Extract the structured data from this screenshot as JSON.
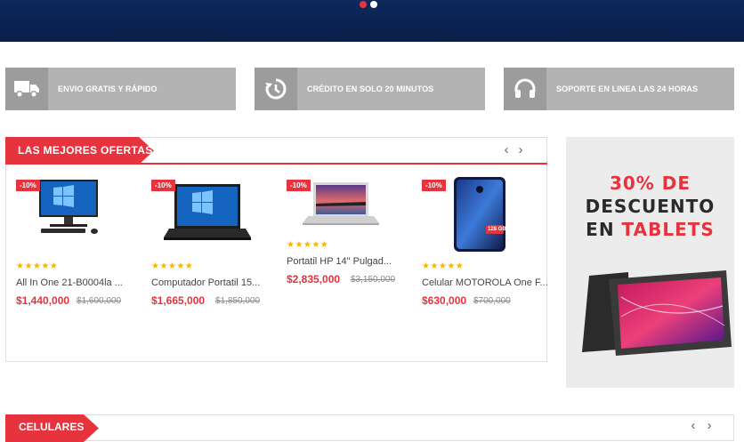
{
  "hero": {
    "slides": 2,
    "active_slide": 1
  },
  "features": [
    {
      "icon": "truck-icon",
      "label": "ENVIO GRATIS Y RÁPIDO"
    },
    {
      "icon": "history-icon",
      "label": "CRÉDITO EN SOLO 20 MINUTOS"
    },
    {
      "icon": "headphones-icon",
      "label": "SOPORTE EN LINEA LAS 24 HORAS"
    }
  ],
  "deals": {
    "title": "LAS MEJORES OFERTAS",
    "prev_arrow": "‹",
    "next_arrow": "›",
    "products": [
      {
        "badge": "-10%",
        "rating": "★★★★★",
        "name": "All In One 21-B0004la ...",
        "price": "$1,440,000",
        "old_price": "$1,600,000"
      },
      {
        "badge": "-10%",
        "rating": "★★★★★",
        "name": "Computador Portatil 15...",
        "price": "$1,665,000",
        "old_price": "$1,850,000"
      },
      {
        "badge": "-10%",
        "rating": "★★★★★",
        "name": "Portatil HP 14\" Pulgad...",
        "price": "$2,835,000",
        "old_price": "$3,150,000"
      },
      {
        "badge": "-10%",
        "rating": "★★★★★",
        "name": "Celular MOTOROLA One F...",
        "price": "$630,000",
        "old_price": "$700,000",
        "tag": "128 GB"
      }
    ]
  },
  "promo": {
    "line1": "30% DE",
    "line2": "DESCUENTO",
    "line3_prefix": "EN ",
    "line3_highlight": "TABLETS"
  },
  "celulares": {
    "title": "CELULARES",
    "prev_arrow": "‹",
    "next_arrow": "›"
  },
  "colors": {
    "accent": "#e7333d",
    "hero": "#0d2a5c",
    "feature_bg": "#b3b3b3",
    "star": "#f5b800"
  }
}
